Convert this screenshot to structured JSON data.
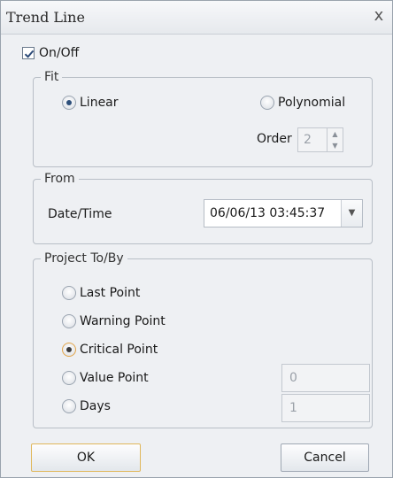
{
  "window": {
    "title": "Trend Line",
    "close_glyph": "x"
  },
  "enable": {
    "label": "On/Off",
    "checked": true
  },
  "fit": {
    "legend": "Fit",
    "linear_label": "Linear",
    "polynomial_label": "Polynomial",
    "selected": "Linear",
    "order_label": "Order",
    "order_value": "2"
  },
  "from": {
    "legend": "From",
    "datetime_label": "Date/Time",
    "datetime_value": "06/06/13 03:45:37"
  },
  "project": {
    "legend": "Project To/By",
    "options": [
      {
        "label": "Last Point"
      },
      {
        "label": "Warning Point"
      },
      {
        "label": "Critical Point"
      },
      {
        "label": "Value Point"
      },
      {
        "label": "Days"
      }
    ],
    "selected": "Critical Point",
    "value_point_value": "0",
    "days_value": "1"
  },
  "buttons": {
    "ok_label": "OK",
    "cancel_label": "Cancel"
  }
}
